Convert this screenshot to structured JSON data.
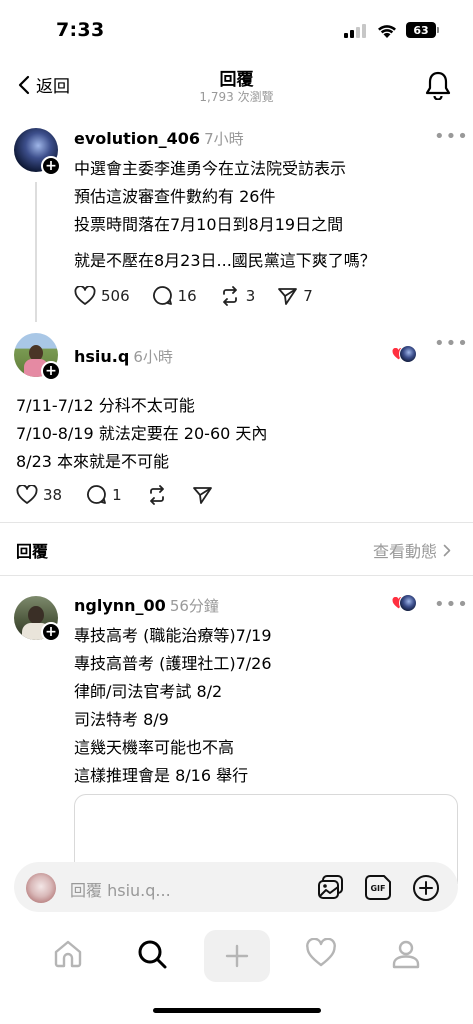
{
  "status_bar": {
    "time": "7:33",
    "battery": "63"
  },
  "header": {
    "back_label": "返回",
    "title": "回覆",
    "subtitle": "1,793 次瀏覽"
  },
  "original_post": {
    "username": "evolution_406",
    "time_ago": "7小時",
    "lines": [
      "中選會主委李進勇今在立法院受訪表示",
      "預估這波審查件數約有 26件",
      "投票時間落在7月10日到8月19日之間",
      "就是不壓在8月23日...國民黨這下爽了嗎？"
    ],
    "likes": "506",
    "comments": "16",
    "reposts": "3",
    "shares": "7"
  },
  "reply_post": {
    "username": "hsiu.q",
    "time_ago": "6小時",
    "lines": [
      "7/11-7/12 分科不太可能",
      "7/10-8/19 就法定要在 20-60 天內",
      "8/23 本來就是不可能"
    ],
    "likes": "38",
    "comments": "1"
  },
  "replies_section": {
    "label": "回覆",
    "activity_link": "查看動態"
  },
  "nested_reply": {
    "username": "nglynn_00",
    "time_ago": "56分鐘",
    "lines": [
      "專技高考 (職能治療等)7/19",
      "專技高普考 (護理社工)7/26",
      "律師/司法官考試 8/2",
      "司法特考 8/9",
      "這幾天機率可能也不高",
      "這樣推理會是 8/16 舉行"
    ]
  },
  "compose": {
    "placeholder": "回覆 hsiu.q..."
  },
  "colors": {
    "like_red": "#ff3040",
    "muted": "#999999",
    "divider": "#e5e5e5"
  }
}
